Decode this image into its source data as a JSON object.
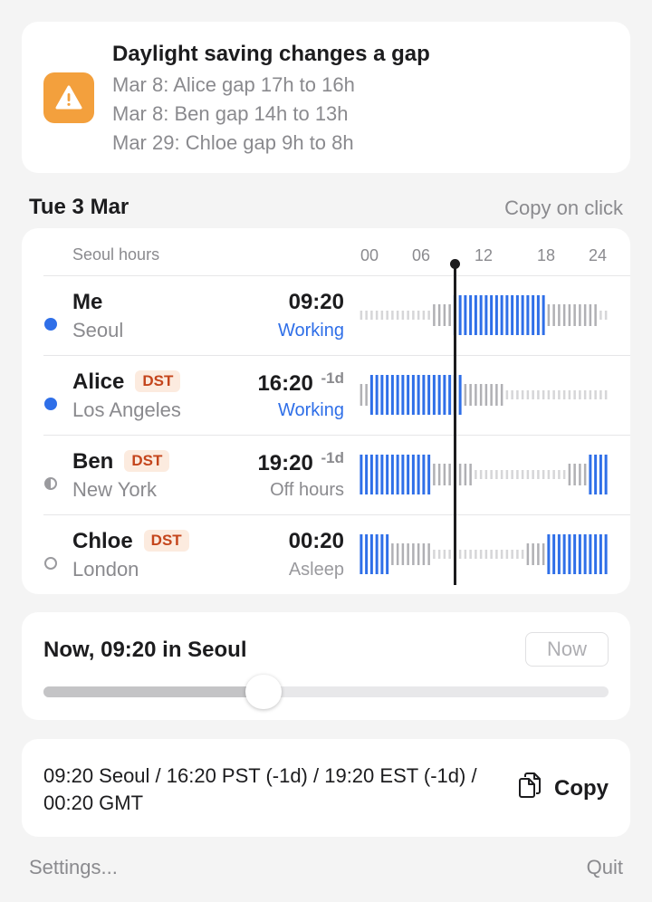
{
  "alert": {
    "title": "Daylight saving changes a gap",
    "icon": "warning-icon",
    "color": "#f3a03d",
    "lines": [
      "Mar 8: Alice gap 17h to 16h",
      "Mar 8: Ben gap 14h to 13h",
      "Mar 29: Chloe gap 9h to 8h"
    ]
  },
  "date_label": "Tue 3 Mar",
  "copy_on_click": "Copy on click",
  "timeline": {
    "header_label": "Seoul hours",
    "ticks": [
      "00",
      "06",
      "12",
      "18",
      "24"
    ],
    "now_hour": 9.333,
    "colors": {
      "work": "#2f6fe8",
      "awake": "#b0b0b4",
      "sleep": "#d6d6d8"
    }
  },
  "people": [
    {
      "name": "Me",
      "dst": "",
      "city": "Seoul",
      "time": "09:20",
      "offset": "",
      "status": "Working",
      "status_type": "working",
      "dot": "full",
      "work": [
        9,
        18
      ],
      "awake": [
        7,
        23
      ]
    },
    {
      "name": "Alice",
      "dst": "DST",
      "city": "Los Angeles",
      "time": "16:20",
      "offset": "-1d",
      "status": "Working",
      "status_type": "working",
      "dot": "full",
      "work": [
        1,
        10
      ],
      "awake": [
        0,
        14
      ]
    },
    {
      "name": "Ben",
      "dst": "DST",
      "city": "New York",
      "time": "19:20",
      "offset": "-1d",
      "status": "Off hours",
      "status_type": "off",
      "dot": "half",
      "work": [
        22,
        31
      ],
      "awake": [
        20,
        35
      ]
    },
    {
      "name": "Chloe",
      "dst": "DST",
      "city": "London",
      "time": "00:20",
      "offset": "",
      "status": "Asleep",
      "status_type": "asleep",
      "dot": "empty",
      "work": [
        18,
        27
      ],
      "awake": [
        16,
        31
      ]
    }
  ],
  "now_panel": {
    "label": "Now, 09:20 in Seoul",
    "button": "Now",
    "slider_value": 0.389
  },
  "copy_panel": {
    "text": "09:20 Seoul / 16:20 PST (-1d) / 19:20 EST (-1d) / 00:20 GMT",
    "button": "Copy",
    "icon": "copy-icon"
  },
  "footer": {
    "settings": "Settings...",
    "quit": "Quit"
  }
}
